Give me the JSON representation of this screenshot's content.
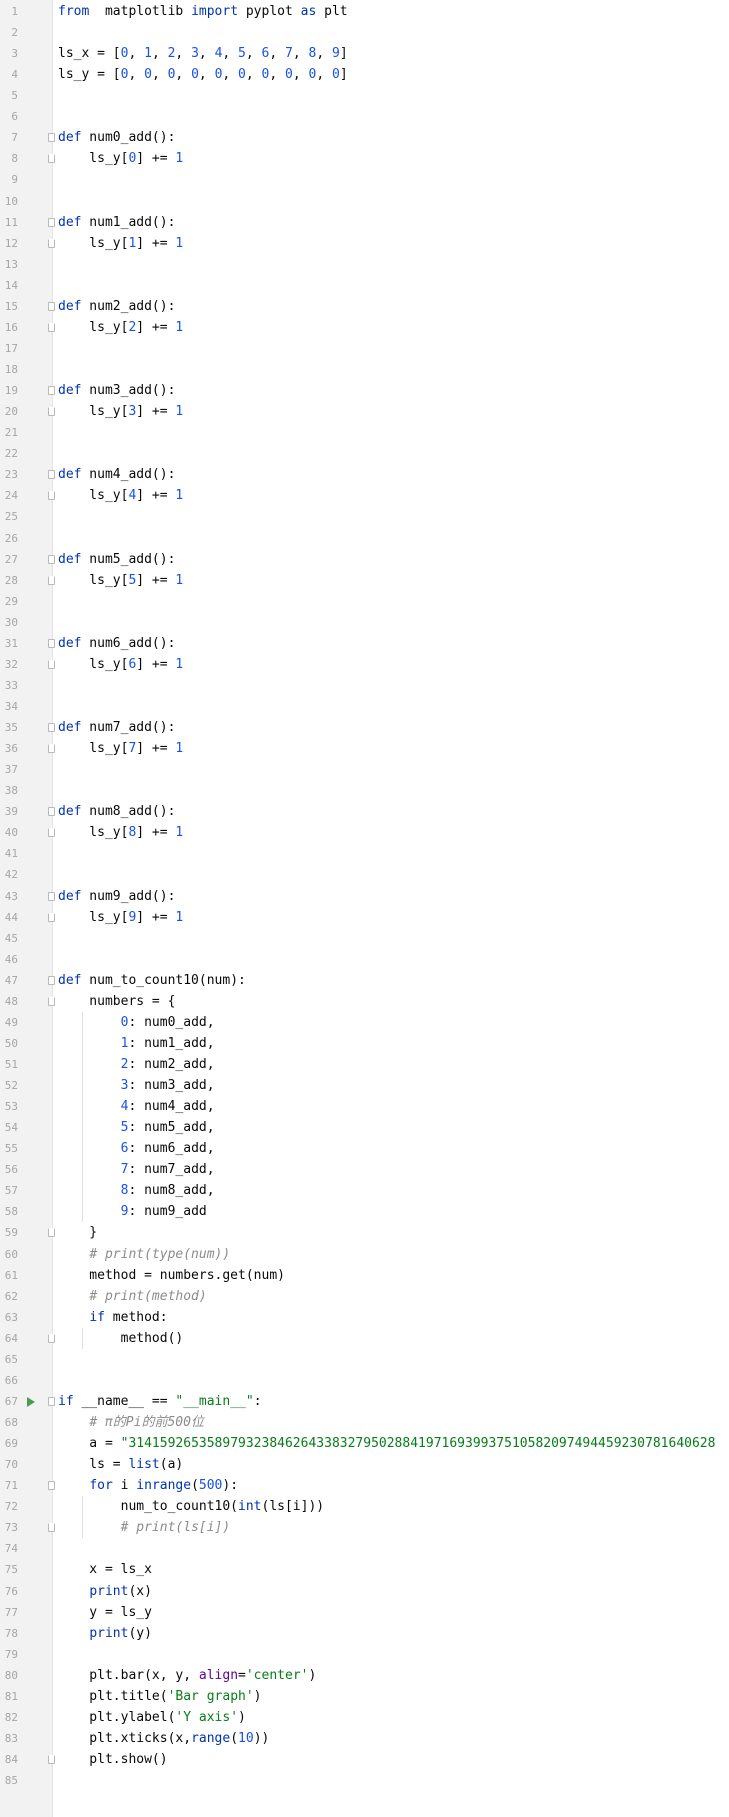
{
  "editor": {
    "language": "Python",
    "run_marker_line": 67,
    "caret_line": 85,
    "lines": [
      {
        "n": "1",
        "t": [
          [
            "kw",
            "from"
          ],
          [
            "",
            "  matplotlib "
          ],
          [
            "kw",
            "import"
          ],
          [
            "",
            " pyplot "
          ],
          [
            "kw",
            "as"
          ],
          [
            "",
            " plt"
          ]
        ]
      },
      {
        "n": "2",
        "t": []
      },
      {
        "n": "3",
        "t": [
          [
            "",
            "ls_x = ["
          ],
          [
            "num",
            "0"
          ],
          [
            "",
            ", "
          ],
          [
            "num",
            "1"
          ],
          [
            "",
            ", "
          ],
          [
            "num",
            "2"
          ],
          [
            "",
            ", "
          ],
          [
            "num",
            "3"
          ],
          [
            "",
            ", "
          ],
          [
            "num",
            "4"
          ],
          [
            "",
            ", "
          ],
          [
            "num",
            "5"
          ],
          [
            "",
            ", "
          ],
          [
            "num",
            "6"
          ],
          [
            "",
            ", "
          ],
          [
            "num",
            "7"
          ],
          [
            "",
            ", "
          ],
          [
            "num",
            "8"
          ],
          [
            "",
            ", "
          ],
          [
            "num",
            "9"
          ],
          [
            "",
            "]"
          ]
        ]
      },
      {
        "n": "4",
        "t": [
          [
            "",
            "ls_y = ["
          ],
          [
            "num",
            "0"
          ],
          [
            "",
            ", "
          ],
          [
            "num",
            "0"
          ],
          [
            "",
            ", "
          ],
          [
            "num",
            "0"
          ],
          [
            "",
            ", "
          ],
          [
            "num",
            "0"
          ],
          [
            "",
            ", "
          ],
          [
            "num",
            "0"
          ],
          [
            "",
            ", "
          ],
          [
            "num",
            "0"
          ],
          [
            "",
            ", "
          ],
          [
            "num",
            "0"
          ],
          [
            "",
            ", "
          ],
          [
            "num",
            "0"
          ],
          [
            "",
            ", "
          ],
          [
            "num",
            "0"
          ],
          [
            "",
            ", "
          ],
          [
            "num",
            "0"
          ],
          [
            "",
            "]"
          ]
        ]
      },
      {
        "n": "5",
        "t": []
      },
      {
        "n": "6",
        "t": []
      },
      {
        "n": "7",
        "t": [
          [
            "kw",
            "def"
          ],
          [
            "",
            " num0_add():"
          ]
        ]
      },
      {
        "n": "8",
        "t": [
          [
            "",
            "    ls_y["
          ],
          [
            "num",
            "0"
          ],
          [
            "",
            "] += "
          ],
          [
            "num",
            "1"
          ]
        ]
      },
      {
        "n": "9",
        "t": []
      },
      {
        "n": "10",
        "t": []
      },
      {
        "n": "11",
        "t": [
          [
            "kw",
            "def"
          ],
          [
            "",
            " num1_add():"
          ]
        ]
      },
      {
        "n": "12",
        "t": [
          [
            "",
            "    ls_y["
          ],
          [
            "num",
            "1"
          ],
          [
            "",
            "] += "
          ],
          [
            "num",
            "1"
          ]
        ]
      },
      {
        "n": "13",
        "t": []
      },
      {
        "n": "14",
        "t": []
      },
      {
        "n": "15",
        "t": [
          [
            "kw",
            "def"
          ],
          [
            "",
            " num2_add():"
          ]
        ]
      },
      {
        "n": "16",
        "t": [
          [
            "",
            "    ls_y["
          ],
          [
            "num",
            "2"
          ],
          [
            "",
            "] += "
          ],
          [
            "num",
            "1"
          ]
        ]
      },
      {
        "n": "17",
        "t": []
      },
      {
        "n": "18",
        "t": []
      },
      {
        "n": "19",
        "t": [
          [
            "kw",
            "def"
          ],
          [
            "",
            " num3_add():"
          ]
        ]
      },
      {
        "n": "20",
        "t": [
          [
            "",
            "    ls_y["
          ],
          [
            "num",
            "3"
          ],
          [
            "",
            "] += "
          ],
          [
            "num",
            "1"
          ]
        ]
      },
      {
        "n": "21",
        "t": []
      },
      {
        "n": "22",
        "t": []
      },
      {
        "n": "23",
        "t": [
          [
            "kw",
            "def"
          ],
          [
            "",
            " num4_add():"
          ]
        ]
      },
      {
        "n": "24",
        "t": [
          [
            "",
            "    ls_y["
          ],
          [
            "num",
            "4"
          ],
          [
            "",
            "] += "
          ],
          [
            "num",
            "1"
          ]
        ]
      },
      {
        "n": "25",
        "t": []
      },
      {
        "n": "26",
        "t": []
      },
      {
        "n": "27",
        "t": [
          [
            "kw",
            "def"
          ],
          [
            "",
            " num5_add():"
          ]
        ]
      },
      {
        "n": "28",
        "t": [
          [
            "",
            "    ls_y["
          ],
          [
            "num",
            "5"
          ],
          [
            "",
            "] += "
          ],
          [
            "num",
            "1"
          ]
        ]
      },
      {
        "n": "29",
        "t": []
      },
      {
        "n": "30",
        "t": []
      },
      {
        "n": "31",
        "t": [
          [
            "kw",
            "def"
          ],
          [
            "",
            " num6_add():"
          ]
        ]
      },
      {
        "n": "32",
        "t": [
          [
            "",
            "    ls_y["
          ],
          [
            "num",
            "6"
          ],
          [
            "",
            "] += "
          ],
          [
            "num",
            "1"
          ]
        ]
      },
      {
        "n": "33",
        "t": []
      },
      {
        "n": "34",
        "t": []
      },
      {
        "n": "35",
        "t": [
          [
            "kw",
            "def"
          ],
          [
            "",
            " num7_add():"
          ]
        ]
      },
      {
        "n": "36",
        "t": [
          [
            "",
            "    ls_y["
          ],
          [
            "num",
            "7"
          ],
          [
            "",
            "] += "
          ],
          [
            "num",
            "1"
          ]
        ]
      },
      {
        "n": "37",
        "t": []
      },
      {
        "n": "38",
        "t": []
      },
      {
        "n": "39",
        "t": [
          [
            "kw",
            "def"
          ],
          [
            "",
            " num8_add():"
          ]
        ]
      },
      {
        "n": "40",
        "t": [
          [
            "",
            "    ls_y["
          ],
          [
            "num",
            "8"
          ],
          [
            "",
            "] += "
          ],
          [
            "num",
            "1"
          ]
        ]
      },
      {
        "n": "41",
        "t": []
      },
      {
        "n": "42",
        "t": []
      },
      {
        "n": "43",
        "t": [
          [
            "kw",
            "def"
          ],
          [
            "",
            " num9_add():"
          ]
        ]
      },
      {
        "n": "44",
        "t": [
          [
            "",
            "    ls_y["
          ],
          [
            "num",
            "9"
          ],
          [
            "",
            "] += "
          ],
          [
            "num",
            "1"
          ]
        ]
      },
      {
        "n": "45",
        "t": []
      },
      {
        "n": "46",
        "t": []
      },
      {
        "n": "47",
        "t": [
          [
            "kw",
            "def"
          ],
          [
            "",
            " num_to_count10(num):"
          ]
        ]
      },
      {
        "n": "48",
        "t": [
          [
            "",
            "    numbers = {"
          ]
        ]
      },
      {
        "n": "49",
        "t": [
          [
            "",
            "        "
          ],
          [
            "num",
            "0"
          ],
          [
            "",
            ": num0_add,"
          ]
        ]
      },
      {
        "n": "50",
        "t": [
          [
            "",
            "        "
          ],
          [
            "num",
            "1"
          ],
          [
            "",
            ": num1_add,"
          ]
        ]
      },
      {
        "n": "51",
        "t": [
          [
            "",
            "        "
          ],
          [
            "num",
            "2"
          ],
          [
            "",
            ": num2_add,"
          ]
        ]
      },
      {
        "n": "52",
        "t": [
          [
            "",
            "        "
          ],
          [
            "num",
            "3"
          ],
          [
            "",
            ": num3_add,"
          ]
        ]
      },
      {
        "n": "53",
        "t": [
          [
            "",
            "        "
          ],
          [
            "num",
            "4"
          ],
          [
            "",
            ": num4_add,"
          ]
        ]
      },
      {
        "n": "54",
        "t": [
          [
            "",
            "        "
          ],
          [
            "num",
            "5"
          ],
          [
            "",
            ": num5_add,"
          ]
        ]
      },
      {
        "n": "55",
        "t": [
          [
            "",
            "        "
          ],
          [
            "num",
            "6"
          ],
          [
            "",
            ": num6_add,"
          ]
        ]
      },
      {
        "n": "56",
        "t": [
          [
            "",
            "        "
          ],
          [
            "num",
            "7"
          ],
          [
            "",
            ": num7_add,"
          ]
        ]
      },
      {
        "n": "57",
        "t": [
          [
            "",
            "        "
          ],
          [
            "num",
            "8"
          ],
          [
            "",
            ": num8_add,"
          ]
        ]
      },
      {
        "n": "58",
        "t": [
          [
            "",
            "        "
          ],
          [
            "num",
            "9"
          ],
          [
            "",
            ": num9_add"
          ]
        ]
      },
      {
        "n": "59",
        "t": [
          [
            "",
            "    }"
          ]
        ]
      },
      {
        "n": "60",
        "t": [
          [
            "",
            "    "
          ],
          [
            "cmt",
            "# print(type(num))"
          ]
        ]
      },
      {
        "n": "61",
        "t": [
          [
            "",
            "    method = numbers.get(num)"
          ]
        ]
      },
      {
        "n": "62",
        "t": [
          [
            "",
            "    "
          ],
          [
            "cmt",
            "# print(method)"
          ]
        ]
      },
      {
        "n": "63",
        "t": [
          [
            "",
            "    "
          ],
          [
            "kw",
            "if"
          ],
          [
            "",
            " method:"
          ]
        ]
      },
      {
        "n": "64",
        "t": [
          [
            "",
            "        method()"
          ]
        ]
      },
      {
        "n": "65",
        "t": []
      },
      {
        "n": "66",
        "t": []
      },
      {
        "n": "67",
        "t": [
          [
            "kw",
            "if"
          ],
          [
            "",
            " __name__ == "
          ],
          [
            "str",
            "\"__main__\""
          ],
          [
            "",
            ":"
          ]
        ]
      },
      {
        "n": "68",
        "t": [
          [
            "",
            "    "
          ],
          [
            "cmt",
            "# π的Pi的前500位"
          ]
        ]
      },
      {
        "n": "69",
        "t": [
          [
            "",
            "    a = "
          ],
          [
            "str",
            "\"314159265358979323846264338327950288419716939937510582097494459230781640628"
          ]
        ]
      },
      {
        "n": "70",
        "t": [
          [
            "",
            "    ls = "
          ],
          [
            "kw",
            "list"
          ],
          [
            "",
            "(a)"
          ]
        ]
      },
      {
        "n": "71",
        "t": [
          [
            "",
            "    "
          ],
          [
            "kw",
            "for"
          ],
          [
            "",
            " i "
          ],
          [
            "kw",
            "in"
          ],
          [
            "",
            "",
            " "
          ],
          [
            "kw",
            "range"
          ],
          [
            "",
            "("
          ],
          [
            "num",
            "500"
          ],
          [
            "",
            "):"
          ]
        ]
      },
      {
        "n": "72",
        "t": [
          [
            "",
            "        num_to_count10("
          ],
          [
            "kw",
            "int"
          ],
          [
            "",
            "(ls[i]))"
          ]
        ]
      },
      {
        "n": "73",
        "t": [
          [
            "",
            "        "
          ],
          [
            "cmt",
            "# print(ls[i])"
          ]
        ]
      },
      {
        "n": "74",
        "t": []
      },
      {
        "n": "75",
        "t": [
          [
            "",
            "    x = ls_x"
          ]
        ]
      },
      {
        "n": "76",
        "t": [
          [
            "",
            "    "
          ],
          [
            "kw",
            "print"
          ],
          [
            "",
            "(x)"
          ]
        ]
      },
      {
        "n": "77",
        "t": [
          [
            "",
            "    y = ls_y"
          ]
        ]
      },
      {
        "n": "78",
        "t": [
          [
            "",
            "    "
          ],
          [
            "kw",
            "print"
          ],
          [
            "",
            "(y)"
          ]
        ]
      },
      {
        "n": "79",
        "t": []
      },
      {
        "n": "80",
        "t": [
          [
            "",
            "    plt.bar(x, y, "
          ],
          [
            "kwarg",
            "align"
          ],
          [
            "",
            "="
          ],
          [
            "str",
            "'center'"
          ],
          [
            "",
            ")"
          ]
        ]
      },
      {
        "n": "81",
        "t": [
          [
            "",
            "    plt.title("
          ],
          [
            "str",
            "'Bar graph'"
          ],
          [
            "",
            ")"
          ]
        ]
      },
      {
        "n": "82",
        "t": [
          [
            "",
            "    plt.ylabel("
          ],
          [
            "str",
            "'Y axis'"
          ],
          [
            "",
            ")"
          ]
        ]
      },
      {
        "n": "83",
        "t": [
          [
            "",
            "    plt.xticks(x,"
          ],
          [
            "kw",
            "range"
          ],
          [
            "",
            "("
          ],
          [
            "num",
            "10"
          ],
          [
            "",
            "))"
          ]
        ]
      },
      {
        "n": "84",
        "t": [
          [
            "",
            "    plt.show()"
          ]
        ]
      },
      {
        "n": "85",
        "t": []
      }
    ],
    "fold_starts": [
      7,
      11,
      15,
      19,
      23,
      27,
      31,
      35,
      39,
      43,
      47,
      67,
      71
    ],
    "fold_ends": [
      8,
      12,
      16,
      20,
      24,
      28,
      32,
      36,
      40,
      44,
      48,
      59,
      64,
      73,
      84
    ]
  }
}
